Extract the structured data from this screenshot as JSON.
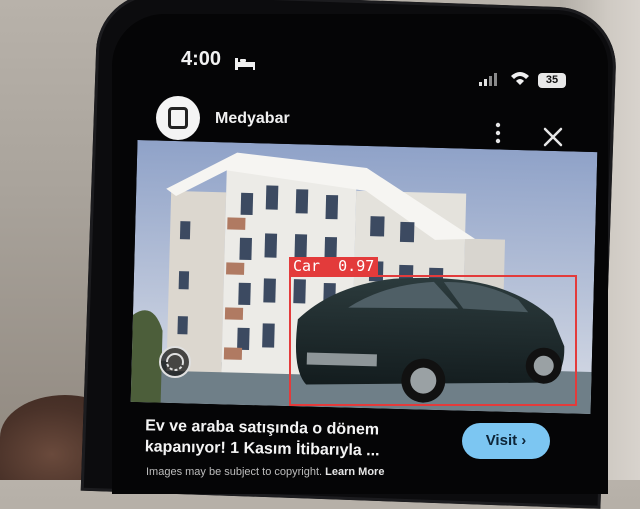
{
  "status_bar": {
    "time": "4:00",
    "battery_level": "35",
    "icons": [
      "bed-icon",
      "signal-icon",
      "wifi-icon",
      "battery-icon"
    ]
  },
  "post": {
    "page_name": "Medyabar",
    "headline_lines": [
      "Ev ve araba satışında o dönem",
      "kapanıyor! 1 Kasım İtibarıyla ..."
    ],
    "caption_prefix": "Images may be subject to copyright.",
    "caption_link": "Learn More",
    "cta_label": "Visit ›",
    "icons": [
      "more-icon",
      "close-icon",
      "avatar-icon",
      "panorama-icon"
    ]
  },
  "detection": {
    "label": "Car  0.97",
    "class": "Car",
    "confidence": 0.97,
    "color": "#e33b3b"
  },
  "colors": {
    "screen": "#050506",
    "cta": "#7cc6f2",
    "sky": "#c7cfe0",
    "building": "#ecebe7",
    "car": "#1f2e2f"
  }
}
